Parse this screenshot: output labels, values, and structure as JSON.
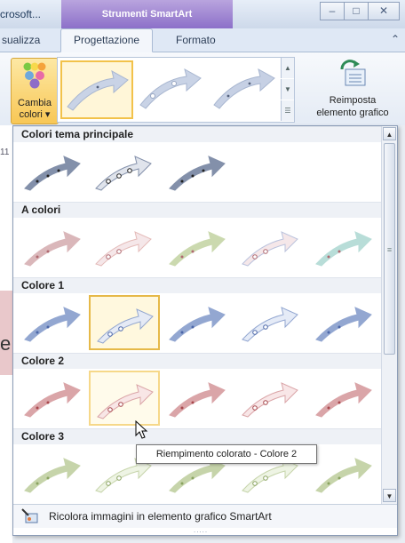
{
  "window": {
    "title_fragment": "crosoft...",
    "context_tab": "Strumenti SmartArt",
    "minimize_glyph": "–",
    "maximize_glyph": "□",
    "close_glyph": "✕"
  },
  "tabs": {
    "visualizza": "sualizza",
    "progettazione": "Progettazione",
    "formato": "Formato",
    "collapse_glyph": "⌃"
  },
  "ribbon": {
    "change_colors_label_line1": "Cambia",
    "change_colors_label_line2": "colori ▾",
    "reset_label_line1": "Reimposta",
    "reset_label_line2": "elemento grafico"
  },
  "document": {
    "side_mark": "11",
    "side_letter": "e"
  },
  "dropdown": {
    "sections": [
      {
        "title": "Colori tema principale",
        "color": "#7d8ba6",
        "dot_color": "#222222",
        "fill_color": "#dfe3ec",
        "selected_index": -1,
        "hover_index": -1,
        "count": 3
      },
      {
        "title": "A colori",
        "color": "#d9b4b7",
        "dot_color": "#b06970",
        "fill_color": "#f5e6e8",
        "selected_index": -1,
        "hover_index": -1,
        "count": 5
      },
      {
        "title": "Colore 1",
        "color": "#8ea3cf",
        "dot_color": "#4c67a8",
        "fill_color": "#e4eaf7",
        "selected_index": 1,
        "hover_index": -1,
        "count": 5
      },
      {
        "title": "Colore 2",
        "color": "#d9a1a4",
        "dot_color": "#a8484d",
        "fill_color": "#f8e5e6",
        "selected_index": -1,
        "hover_index": 1,
        "count": 5
      },
      {
        "title": "Colore 3",
        "color": "#c3d2a6",
        "dot_color": "#8aa360",
        "fill_color": "#eef4e3",
        "selected_index": -1,
        "hover_index": -1,
        "count": 5
      }
    ],
    "a_colori_palette": [
      "#d9b4b7",
      "#e3b8b6",
      "#c9d8ab",
      "#b8c0dc",
      "#b5dcd6"
    ],
    "tooltip": "Riempimento colorato - Colore 2",
    "footer_label": "Ricolora immagini in elemento grafico SmartArt",
    "scroll_up": "▲",
    "scroll_down": "▼",
    "grip": "....."
  }
}
